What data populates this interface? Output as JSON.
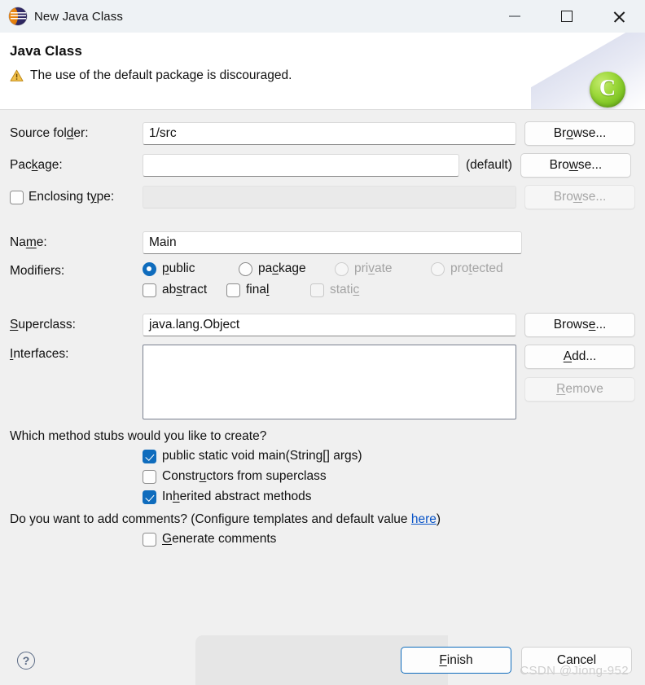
{
  "window": {
    "title": "New Java Class",
    "icon": "eclipse-icon",
    "minimize_label": "Minimize",
    "maximize_label": "Maximize",
    "close_label": "Close"
  },
  "header": {
    "title": "Java Class",
    "message": "The use of the default package is discouraged.",
    "message_icon": "warning-icon",
    "banner_icon": "java-class-icon",
    "banner_icon_letter": "C",
    "warning_color": "#e8a317",
    "banner_icon_color": "#8ecb2e"
  },
  "form": {
    "source_folder": {
      "label_pre": "Source fol",
      "label_mn": "d",
      "label_post": "er:",
      "value": "1/src",
      "browse": {
        "pre": "Br",
        "mn": "o",
        "post": "wse..."
      }
    },
    "package": {
      "label_pre": "Pac",
      "label_mn": "k",
      "label_post": "age:",
      "value": "",
      "note": "(default)",
      "browse": {
        "pre": "Bro",
        "mn": "w",
        "post": "se..."
      }
    },
    "enclosing_type": {
      "label_pre": "Enclosing t",
      "label_mn": "y",
      "label_post": "pe:",
      "checked": false,
      "value": "",
      "browse": {
        "pre": "Bro",
        "mn": "w",
        "post": "se..."
      }
    },
    "name": {
      "label_pre": "Na",
      "label_mn": "m",
      "label_post": "e:",
      "value": "Main"
    },
    "modifiers": {
      "label": "Modifiers:",
      "radios": [
        {
          "pre": "",
          "mn": "p",
          "post": "ublic",
          "selected": true,
          "enabled": true
        },
        {
          "pre": "pa",
          "mn": "c",
          "post": "kage",
          "selected": false,
          "enabled": true
        },
        {
          "pre": "pri",
          "mn": "v",
          "post": "ate",
          "selected": false,
          "enabled": false
        },
        {
          "pre": "pro",
          "mn": "t",
          "post": "ected",
          "selected": false,
          "enabled": false
        }
      ],
      "checkboxes": [
        {
          "pre": "ab",
          "mn": "s",
          "post": "tract",
          "checked": false,
          "enabled": true
        },
        {
          "pre": "fina",
          "mn": "l",
          "post": "",
          "checked": false,
          "enabled": true
        },
        {
          "pre": "stati",
          "mn": "c",
          "post": "",
          "checked": false,
          "enabled": false
        }
      ]
    },
    "superclass": {
      "label_pre": "",
      "label_mn": "S",
      "label_post": "uperclass:",
      "value": "java.lang.Object",
      "browse": {
        "pre": "Brows",
        "mn": "e",
        "post": "..."
      }
    },
    "interfaces": {
      "label_pre": "",
      "label_mn": "I",
      "label_post": "nterfaces:",
      "items": [],
      "add": {
        "pre": "",
        "mn": "A",
        "post": "dd..."
      },
      "remove": {
        "pre": "",
        "mn": "R",
        "post": "emove"
      }
    },
    "stubs": {
      "question": "Which method stubs would you like to create?",
      "options": [
        {
          "pre": "public static void main(String[] args)",
          "mn": "",
          "post": "",
          "checked": true
        },
        {
          "pre": "Constr",
          "mn": "u",
          "post": "ctors from superclass",
          "checked": false
        },
        {
          "pre": "In",
          "mn": "h",
          "post": "erited abstract methods",
          "checked": true
        }
      ]
    },
    "comments": {
      "question_pre": "Do you want to add comments? (Configure templates and default value ",
      "link": "here",
      "question_post": ")",
      "option": {
        "pre": "",
        "mn": "G",
        "post": "enerate comments",
        "checked": false
      }
    }
  },
  "footer": {
    "help_glyph": "?",
    "finish": {
      "pre": "",
      "mn": "F",
      "post": "inish"
    },
    "cancel": {
      "pre": "Cancel",
      "mn": "",
      "post": ""
    }
  },
  "watermark": "CSDN @Jiong-952"
}
